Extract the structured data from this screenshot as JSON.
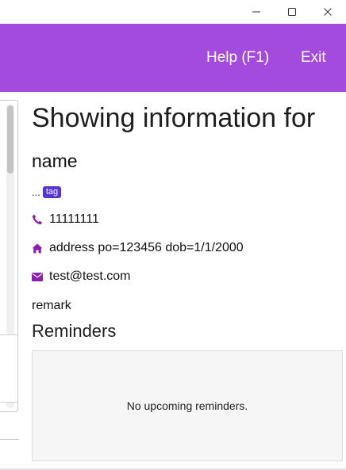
{
  "window": {
    "controls": [
      "minimize-icon",
      "maximize-icon",
      "close-icon"
    ]
  },
  "header": {
    "background": "#a34bdc",
    "menu": [
      {
        "label": "Help (F1)"
      },
      {
        "label": "Exit"
      }
    ]
  },
  "detail": {
    "title": "Showing information for",
    "name": "name",
    "ellipsis": "...",
    "tag": "tag",
    "phone": "11111111",
    "address": "address po=123456 dob=1/1/2000",
    "email": "test@test.com",
    "remark": "remark"
  },
  "reminders": {
    "title": "Reminders",
    "empty_message": "No upcoming reminders."
  },
  "colors": {
    "accent": "#a34bdc",
    "icon": "#8a1fb0",
    "tag": "#5535d4"
  }
}
